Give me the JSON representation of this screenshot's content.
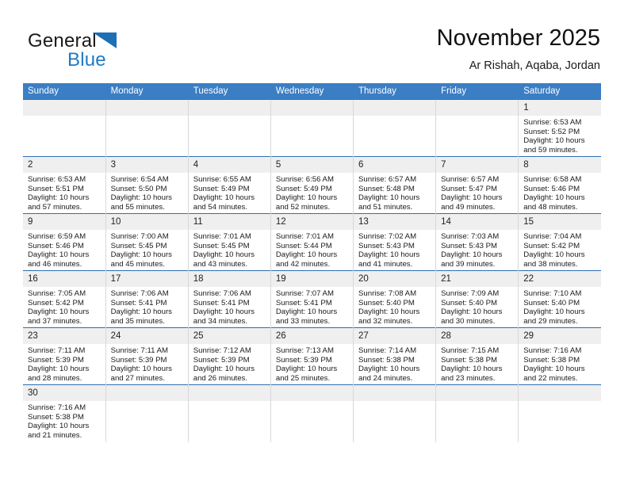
{
  "brand": {
    "name_top": "General",
    "name_bottom": "Blue",
    "flag_icon": "blue-triangle-flag-icon",
    "color_top": "#1a1a1a",
    "color_bottom": "#1f7ac4"
  },
  "header": {
    "title": "November 2025",
    "subtitle": "Ar Rishah, Aqaba, Jordan"
  },
  "theme": {
    "header_blue": "#3b7ec4",
    "row_rule_blue": "#2f6fb0",
    "daynum_band": "#efefef",
    "column_divider": "#d8d8d8"
  },
  "weekday_headers": [
    "Sunday",
    "Monday",
    "Tuesday",
    "Wednesday",
    "Thursday",
    "Friday",
    "Saturday"
  ],
  "labels": {
    "sunrise_prefix": "Sunrise:",
    "sunset_prefix": "Sunset:",
    "daylight_prefix": "Daylight:"
  },
  "weeks": [
    [
      {
        "day": "",
        "sunrise": "",
        "sunset": "",
        "daylight": "",
        "empty": true
      },
      {
        "day": "",
        "sunrise": "",
        "sunset": "",
        "daylight": "",
        "empty": true
      },
      {
        "day": "",
        "sunrise": "",
        "sunset": "",
        "daylight": "",
        "empty": true
      },
      {
        "day": "",
        "sunrise": "",
        "sunset": "",
        "daylight": "",
        "empty": true
      },
      {
        "day": "",
        "sunrise": "",
        "sunset": "",
        "daylight": "",
        "empty": true
      },
      {
        "day": "",
        "sunrise": "",
        "sunset": "",
        "daylight": "",
        "empty": true
      },
      {
        "day": "1",
        "sunrise": "Sunrise: 6:53 AM",
        "sunset": "Sunset: 5:52 PM",
        "daylight": "Daylight: 10 hours and 59 minutes.",
        "empty": false
      }
    ],
    [
      {
        "day": "2",
        "sunrise": "Sunrise: 6:53 AM",
        "sunset": "Sunset: 5:51 PM",
        "daylight": "Daylight: 10 hours and 57 minutes.",
        "empty": false
      },
      {
        "day": "3",
        "sunrise": "Sunrise: 6:54 AM",
        "sunset": "Sunset: 5:50 PM",
        "daylight": "Daylight: 10 hours and 55 minutes.",
        "empty": false
      },
      {
        "day": "4",
        "sunrise": "Sunrise: 6:55 AM",
        "sunset": "Sunset: 5:49 PM",
        "daylight": "Daylight: 10 hours and 54 minutes.",
        "empty": false
      },
      {
        "day": "5",
        "sunrise": "Sunrise: 6:56 AM",
        "sunset": "Sunset: 5:49 PM",
        "daylight": "Daylight: 10 hours and 52 minutes.",
        "empty": false
      },
      {
        "day": "6",
        "sunrise": "Sunrise: 6:57 AM",
        "sunset": "Sunset: 5:48 PM",
        "daylight": "Daylight: 10 hours and 51 minutes.",
        "empty": false
      },
      {
        "day": "7",
        "sunrise": "Sunrise: 6:57 AM",
        "sunset": "Sunset: 5:47 PM",
        "daylight": "Daylight: 10 hours and 49 minutes.",
        "empty": false
      },
      {
        "day": "8",
        "sunrise": "Sunrise: 6:58 AM",
        "sunset": "Sunset: 5:46 PM",
        "daylight": "Daylight: 10 hours and 48 minutes.",
        "empty": false
      }
    ],
    [
      {
        "day": "9",
        "sunrise": "Sunrise: 6:59 AM",
        "sunset": "Sunset: 5:46 PM",
        "daylight": "Daylight: 10 hours and 46 minutes.",
        "empty": false
      },
      {
        "day": "10",
        "sunrise": "Sunrise: 7:00 AM",
        "sunset": "Sunset: 5:45 PM",
        "daylight": "Daylight: 10 hours and 45 minutes.",
        "empty": false
      },
      {
        "day": "11",
        "sunrise": "Sunrise: 7:01 AM",
        "sunset": "Sunset: 5:45 PM",
        "daylight": "Daylight: 10 hours and 43 minutes.",
        "empty": false
      },
      {
        "day": "12",
        "sunrise": "Sunrise: 7:01 AM",
        "sunset": "Sunset: 5:44 PM",
        "daylight": "Daylight: 10 hours and 42 minutes.",
        "empty": false
      },
      {
        "day": "13",
        "sunrise": "Sunrise: 7:02 AM",
        "sunset": "Sunset: 5:43 PM",
        "daylight": "Daylight: 10 hours and 41 minutes.",
        "empty": false
      },
      {
        "day": "14",
        "sunrise": "Sunrise: 7:03 AM",
        "sunset": "Sunset: 5:43 PM",
        "daylight": "Daylight: 10 hours and 39 minutes.",
        "empty": false
      },
      {
        "day": "15",
        "sunrise": "Sunrise: 7:04 AM",
        "sunset": "Sunset: 5:42 PM",
        "daylight": "Daylight: 10 hours and 38 minutes.",
        "empty": false
      }
    ],
    [
      {
        "day": "16",
        "sunrise": "Sunrise: 7:05 AM",
        "sunset": "Sunset: 5:42 PM",
        "daylight": "Daylight: 10 hours and 37 minutes.",
        "empty": false
      },
      {
        "day": "17",
        "sunrise": "Sunrise: 7:06 AM",
        "sunset": "Sunset: 5:41 PM",
        "daylight": "Daylight: 10 hours and 35 minutes.",
        "empty": false
      },
      {
        "day": "18",
        "sunrise": "Sunrise: 7:06 AM",
        "sunset": "Sunset: 5:41 PM",
        "daylight": "Daylight: 10 hours and 34 minutes.",
        "empty": false
      },
      {
        "day": "19",
        "sunrise": "Sunrise: 7:07 AM",
        "sunset": "Sunset: 5:41 PM",
        "daylight": "Daylight: 10 hours and 33 minutes.",
        "empty": false
      },
      {
        "day": "20",
        "sunrise": "Sunrise: 7:08 AM",
        "sunset": "Sunset: 5:40 PM",
        "daylight": "Daylight: 10 hours and 32 minutes.",
        "empty": false
      },
      {
        "day": "21",
        "sunrise": "Sunrise: 7:09 AM",
        "sunset": "Sunset: 5:40 PM",
        "daylight": "Daylight: 10 hours and 30 minutes.",
        "empty": false
      },
      {
        "day": "22",
        "sunrise": "Sunrise: 7:10 AM",
        "sunset": "Sunset: 5:40 PM",
        "daylight": "Daylight: 10 hours and 29 minutes.",
        "empty": false
      }
    ],
    [
      {
        "day": "23",
        "sunrise": "Sunrise: 7:11 AM",
        "sunset": "Sunset: 5:39 PM",
        "daylight": "Daylight: 10 hours and 28 minutes.",
        "empty": false
      },
      {
        "day": "24",
        "sunrise": "Sunrise: 7:11 AM",
        "sunset": "Sunset: 5:39 PM",
        "daylight": "Daylight: 10 hours and 27 minutes.",
        "empty": false
      },
      {
        "day": "25",
        "sunrise": "Sunrise: 7:12 AM",
        "sunset": "Sunset: 5:39 PM",
        "daylight": "Daylight: 10 hours and 26 minutes.",
        "empty": false
      },
      {
        "day": "26",
        "sunrise": "Sunrise: 7:13 AM",
        "sunset": "Sunset: 5:39 PM",
        "daylight": "Daylight: 10 hours and 25 minutes.",
        "empty": false
      },
      {
        "day": "27",
        "sunrise": "Sunrise: 7:14 AM",
        "sunset": "Sunset: 5:38 PM",
        "daylight": "Daylight: 10 hours and 24 minutes.",
        "empty": false
      },
      {
        "day": "28",
        "sunrise": "Sunrise: 7:15 AM",
        "sunset": "Sunset: 5:38 PM",
        "daylight": "Daylight: 10 hours and 23 minutes.",
        "empty": false
      },
      {
        "day": "29",
        "sunrise": "Sunrise: 7:16 AM",
        "sunset": "Sunset: 5:38 PM",
        "daylight": "Daylight: 10 hours and 22 minutes.",
        "empty": false
      }
    ],
    [
      {
        "day": "30",
        "sunrise": "Sunrise: 7:16 AM",
        "sunset": "Sunset: 5:38 PM",
        "daylight": "Daylight: 10 hours and 21 minutes.",
        "empty": false
      },
      {
        "day": "",
        "sunrise": "",
        "sunset": "",
        "daylight": "",
        "empty": true
      },
      {
        "day": "",
        "sunrise": "",
        "sunset": "",
        "daylight": "",
        "empty": true
      },
      {
        "day": "",
        "sunrise": "",
        "sunset": "",
        "daylight": "",
        "empty": true
      },
      {
        "day": "",
        "sunrise": "",
        "sunset": "",
        "daylight": "",
        "empty": true
      },
      {
        "day": "",
        "sunrise": "",
        "sunset": "",
        "daylight": "",
        "empty": true
      },
      {
        "day": "",
        "sunrise": "",
        "sunset": "",
        "daylight": "",
        "empty": true
      }
    ]
  ]
}
